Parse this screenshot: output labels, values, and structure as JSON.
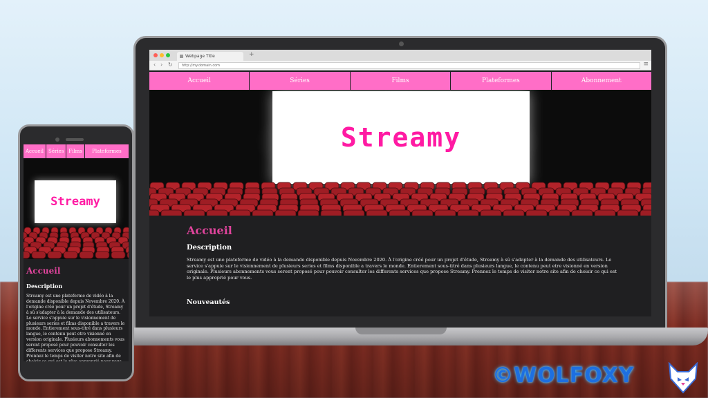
{
  "browser": {
    "tab_title": "Webpage Title",
    "new_tab": "+",
    "back": "‹",
    "forward": "›",
    "reload": "↻",
    "address": "http://my.domain.com",
    "menu": "≡"
  },
  "site": {
    "nav": [
      "Accueil",
      "Séries",
      "Films",
      "Plateformes",
      "Abonnement"
    ],
    "logo": "Streamy",
    "page_title": "Accueil",
    "description_heading": "Description",
    "description_text": "Streamy est une plateforme de vidéo à la demande disponible depuis Novembre 2020. À l'origine créé pour un projet d'étude, Streamy à sû s'adapter à la demande des utilisateurs. Le service s'appuie sur le visionnement de plusieurs series et films disponible a travers le monde. Entierement sous-titré dans plusieurs langue, le contenu peut etre visionné en version originale. Plusieurs abonnements vous seront proposé pour pouvoir consulter les differents services que propose Streamy. Prennez le temps de visiter notre site afin de choisir ce qui est le plus approprié pour vous.",
    "news_heading": "Nouveautés"
  },
  "phone": {
    "nav": [
      "Accueil",
      "Séries",
      "Films",
      "Plateformes"
    ]
  },
  "watermark": {
    "text": "©WOLFOXY"
  },
  "colors": {
    "accent_pink": "#ff6ec7",
    "logo_pink": "#ff1aa3",
    "heading_pink": "#e0449c",
    "seat_red": "#b3232a",
    "watermark_blue": "#1e6fe0"
  }
}
